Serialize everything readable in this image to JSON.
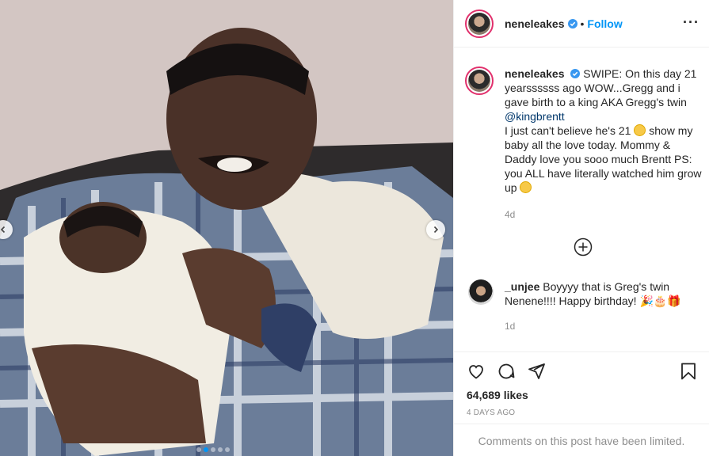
{
  "post": {
    "username": "neneleakes",
    "separator": "•",
    "follow_label": "Follow",
    "more_label": "···",
    "caption": {
      "username": "neneleakes",
      "text_part1": "SWIPE: On this day 21 yearssssss ago WOW...Gregg and i gave birth to a king AKA Gregg's twin",
      "mention": "@kingbrentt",
      "text_part2": "I just can't believe he's 21",
      "text_part3": "show my baby all the love today. Mommy & Daddy love you sooo much Brentt PS: you ALL have literally watched him grow up",
      "time": "4d"
    },
    "comment": {
      "username": "_unjee",
      "text": "Boyyyy that is Greg's twin Nenene!!!! Happy birthday!",
      "emojis": "🎉🎂🎁",
      "time": "1d"
    },
    "likes": "64,689 likes",
    "date": "4 DAYS AGO",
    "comments_limited": "Comments on this post have been limited.",
    "carousel": {
      "count": 5,
      "active_index": 1
    }
  },
  "colors": {
    "accent": "#0095f6",
    "story_ring": "#e1306c",
    "muted": "#8e8e8e"
  }
}
